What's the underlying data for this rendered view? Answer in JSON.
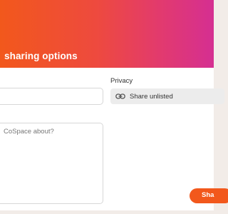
{
  "header": {
    "title": "sharing options"
  },
  "form": {
    "name_value": "",
    "privacy_label": "Privacy",
    "privacy_value": "Share unlisted",
    "privacy_icon": "link-icon",
    "description_placeholder": "CoSpace about?",
    "share_label": "Sha"
  },
  "colors": {
    "header_gradient_start": "#f2581c",
    "header_gradient_end": "#d52f92",
    "share_button": "#f2581c"
  }
}
